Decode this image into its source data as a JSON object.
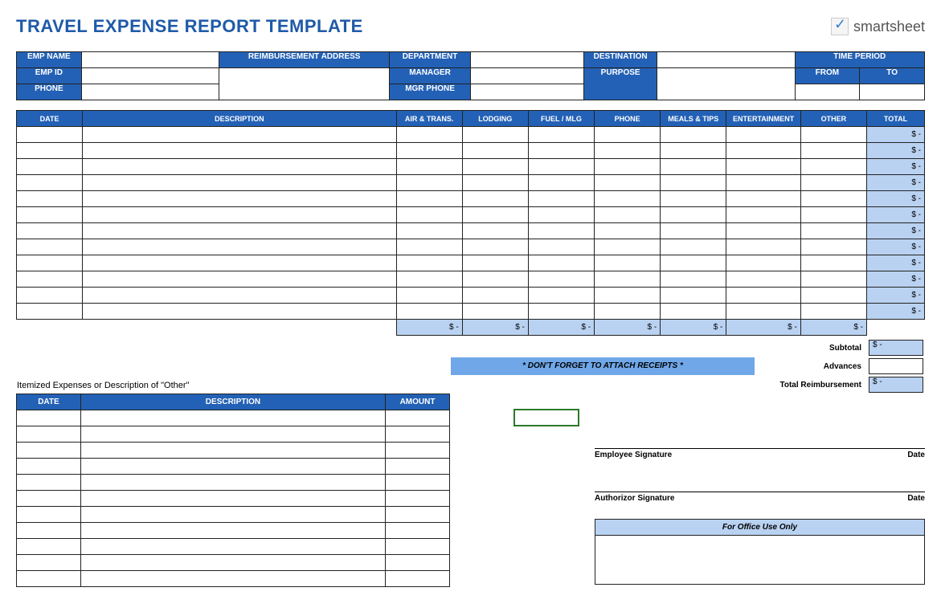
{
  "title": "TRAVEL EXPENSE REPORT TEMPLATE",
  "logo": "smartsheet",
  "info": {
    "emp_name_label": "EMP NAME",
    "reimbursement_label": "REIMBURSEMENT ADDRESS",
    "department_label": "DEPARTMENT",
    "destination_label": "DESTINATION",
    "time_period_label": "TIME PERIOD",
    "emp_id_label": "EMP ID",
    "manager_label": "MANAGER",
    "purpose_label": "PURPOSE",
    "from_label": "FROM",
    "to_label": "TO",
    "phone_label": "PHONE",
    "mgr_phone_label": "MGR PHONE"
  },
  "expense_headers": [
    "DATE",
    "DESCRIPTION",
    "AIR & TRANS.",
    "LODGING",
    "FUEL / MLG",
    "PHONE",
    "MEALS & TIPS",
    "ENTERTAINMENT",
    "OTHER",
    "TOTAL"
  ],
  "expense_rows": 12,
  "row_total_display": "$            -",
  "col_subtotal_display": "$            -",
  "receipts_banner": "* DON'T FORGET TO ATTACH RECEIPTS *",
  "summary": {
    "subtotal_label": "Subtotal",
    "advances_label": "Advances",
    "total_reimbursement_label": "Total Reimbursement",
    "subtotal_val": "$            -",
    "total_reimbursement_val": "$            -"
  },
  "itemized": {
    "heading": "Itemized Expenses or Description of \"Other\"",
    "headers": [
      "DATE",
      "DESCRIPTION",
      "AMOUNT"
    ],
    "rows": 11
  },
  "signatures": {
    "employee": "Employee Signature",
    "authorizor": "Authorizor Signature",
    "date": "Date"
  },
  "office_use": "For Office Use Only"
}
